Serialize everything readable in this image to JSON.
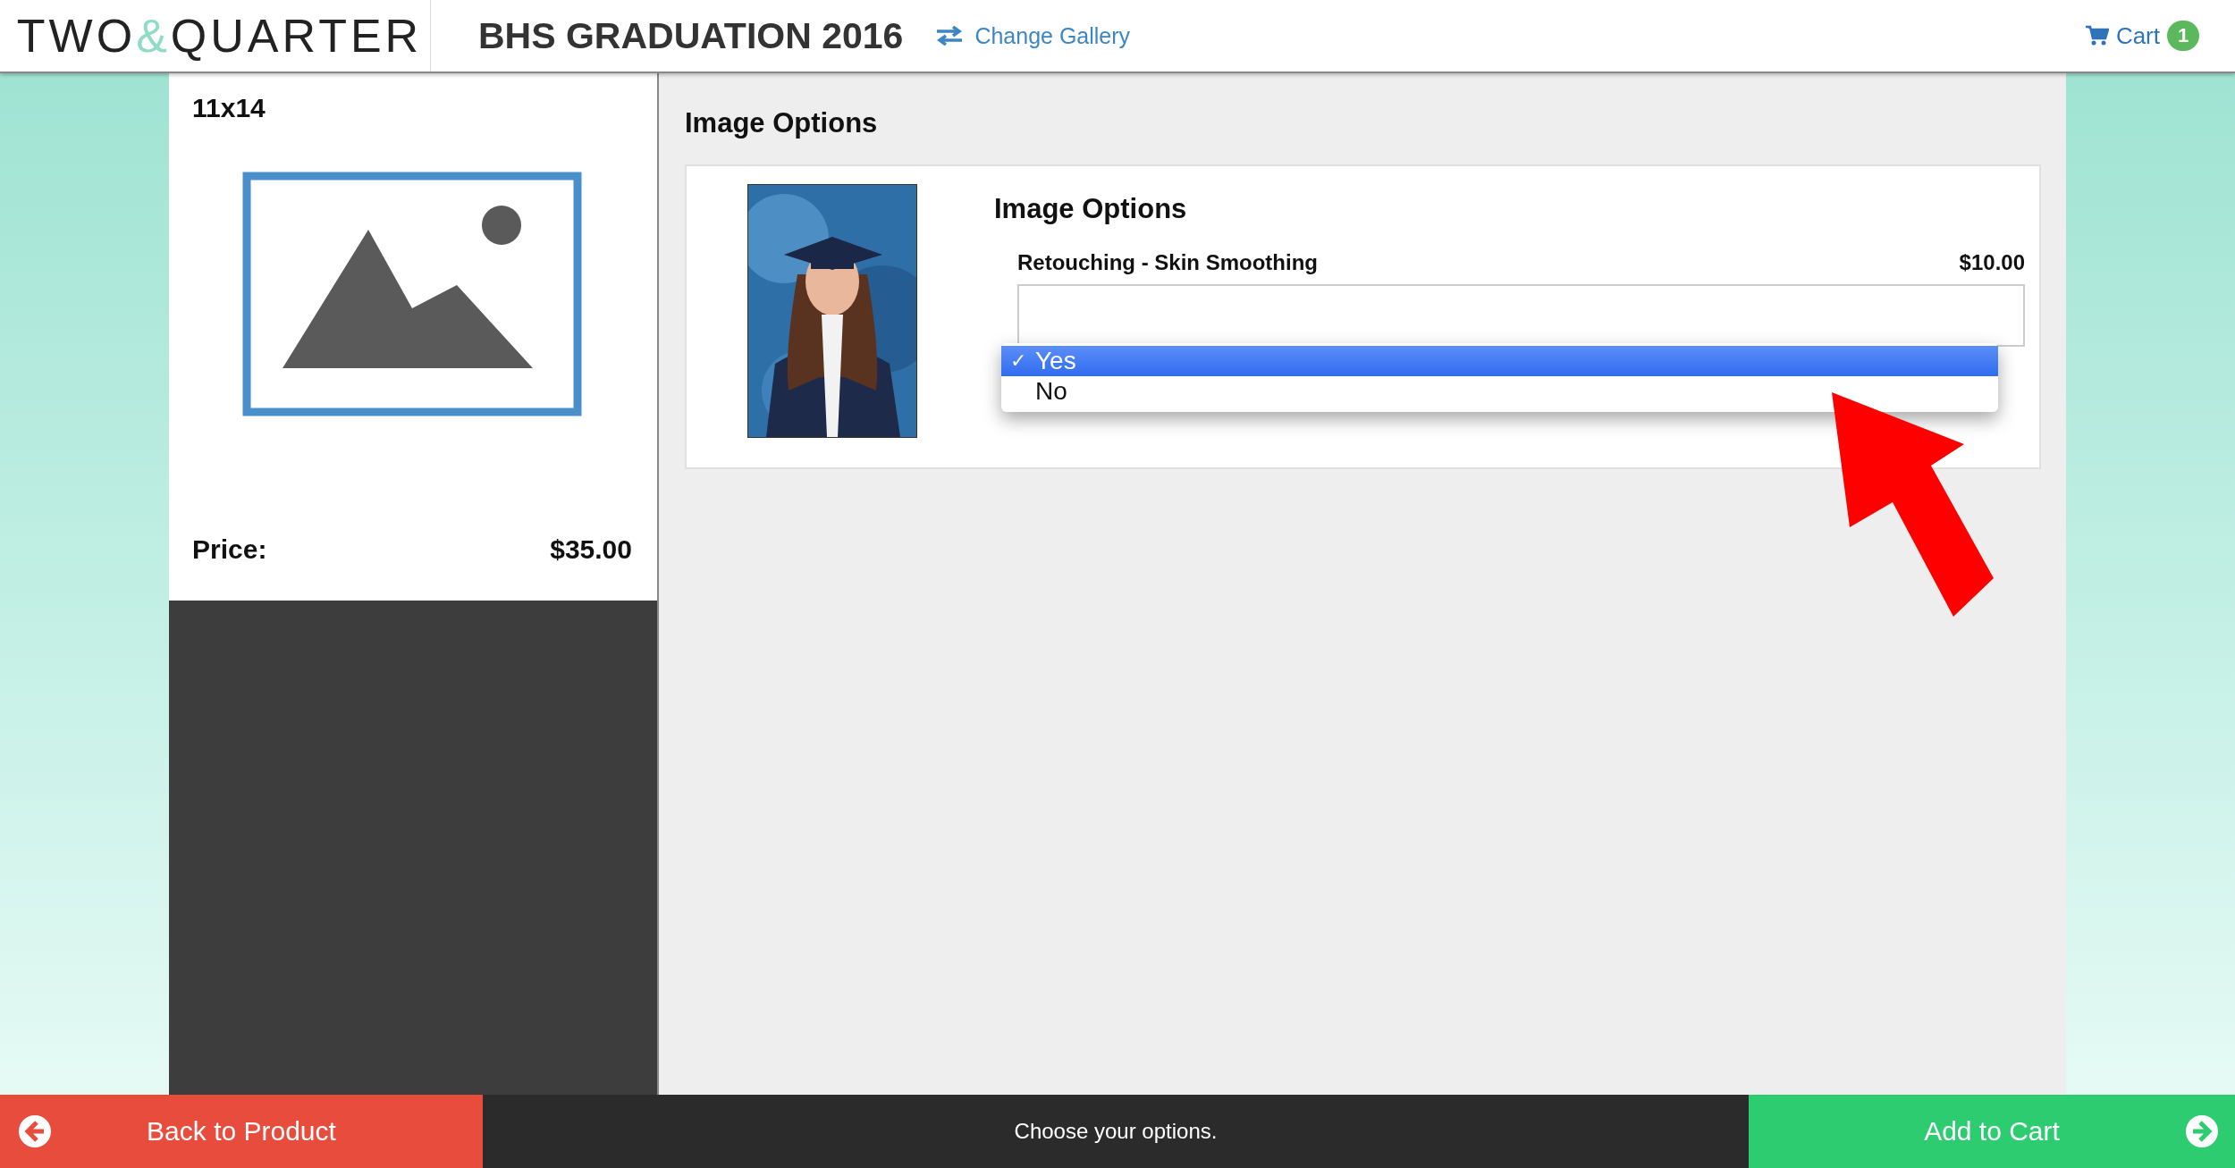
{
  "header": {
    "logo": {
      "left": "TWO",
      "amp": "&",
      "right": "QUARTER"
    },
    "title": "BHS GRADUATION 2016",
    "change_gallery": "Change Gallery",
    "cart": {
      "label": "Cart",
      "count": "1"
    }
  },
  "product": {
    "name": "11x14",
    "price_label": "Price:",
    "price": "$35.00"
  },
  "options": {
    "heading": "Image Options",
    "card_heading": "Image Options",
    "option": {
      "label": "Retouching - Skin Smoothing",
      "price": "$10.00",
      "check_mark": "✓",
      "choices": [
        {
          "label": "Yes",
          "selected": true
        },
        {
          "label": "No",
          "selected": false
        }
      ]
    }
  },
  "footer": {
    "back": "Back to Product",
    "status": "Choose your options.",
    "add": "Add to Cart"
  }
}
